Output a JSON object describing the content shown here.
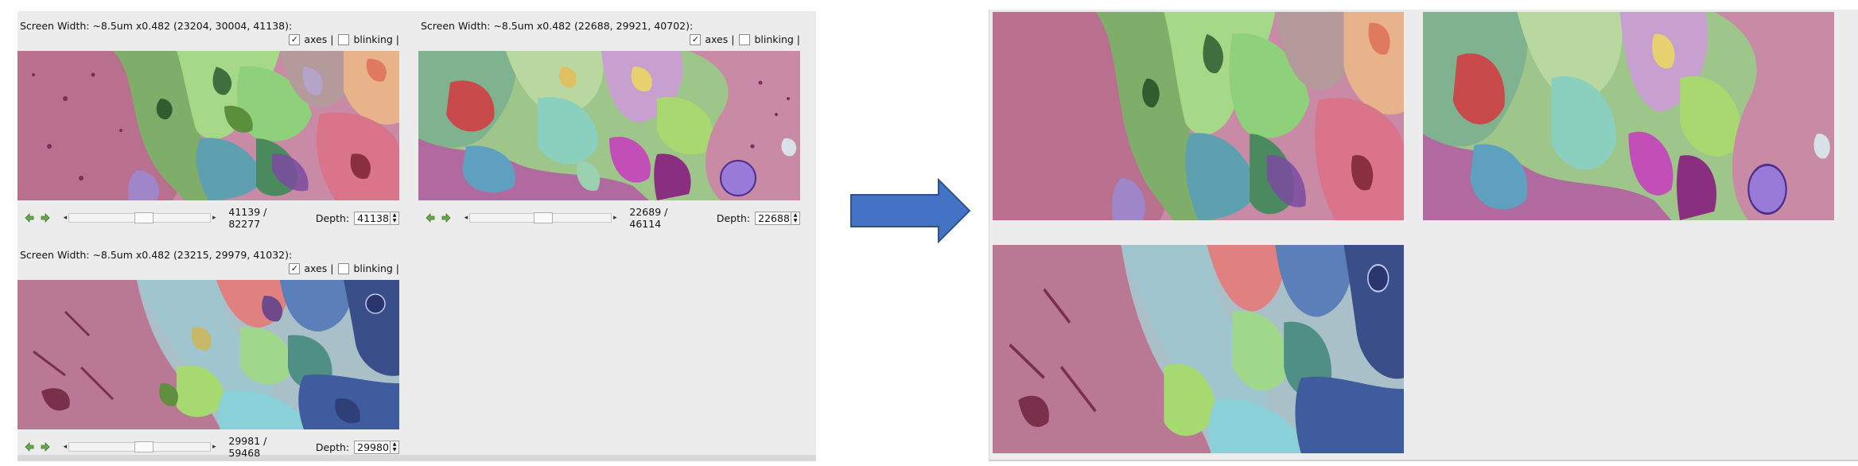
{
  "viewers": [
    {
      "title": "Screen Width: ~8.5um x0.482  (23204, 30004, 41138):",
      "axes_label": "axes |",
      "axes_checked": true,
      "blinking_label": "blinking |",
      "blinking_checked": false,
      "counter": "41139 / 82277",
      "depth_label": "Depth:",
      "depth_value": "41138",
      "slider_fraction": 0.5
    },
    {
      "title": "Screen Width: ~8.5um x0.482  (22688, 29921, 40702):",
      "axes_label": "axes |",
      "axes_checked": true,
      "blinking_label": "blinking |",
      "blinking_checked": false,
      "counter": "22689 / 46114",
      "depth_label": "Depth:",
      "depth_value": "22688",
      "slider_fraction": 0.49
    },
    {
      "title": "Screen Width: ~8.5um x0.482  (23215, 29979, 41032):",
      "axes_label": "axes |",
      "axes_checked": true,
      "blinking_label": "blinking |",
      "blinking_checked": false,
      "counter": "29981 / 59468",
      "depth_label": "Depth:",
      "depth_value": "29980",
      "slider_fraction": 0.5
    }
  ],
  "colors": {
    "panel_bg": "#ececec",
    "arrow_fill": "#4472c4",
    "arrow_stroke": "#2f528f",
    "nav_arrow": "#6aa84f"
  },
  "icons": {
    "prev": "green-left-arrow-icon",
    "next": "green-right-arrow-icon",
    "transition": "blue-right-arrow-icon"
  }
}
